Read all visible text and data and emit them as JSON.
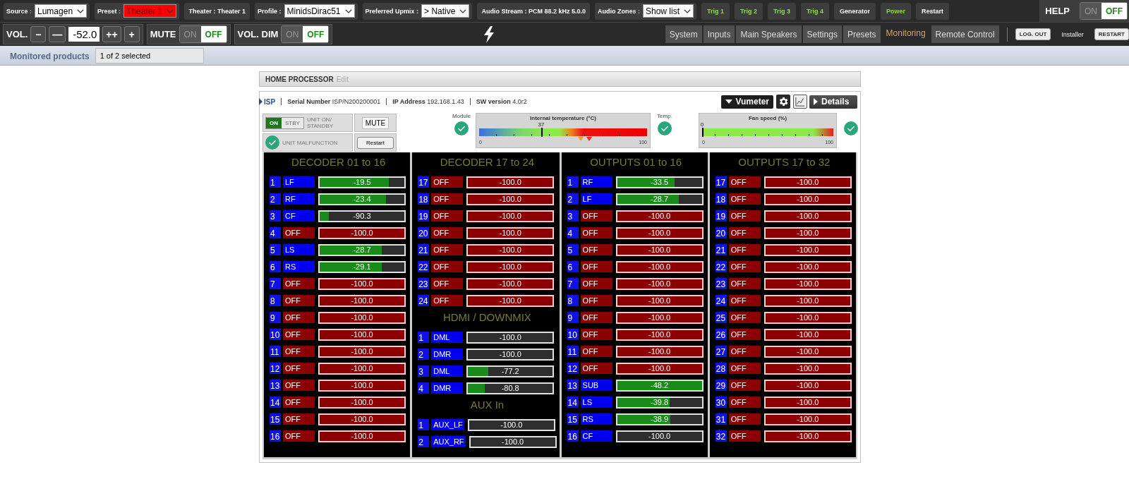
{
  "top_bar": {
    "fields": [
      {
        "kind": "select",
        "label": "Source :",
        "value": "Lumagen",
        "alert": false
      },
      {
        "kind": "select",
        "label": "Preset :",
        "value": "Theater 1",
        "alert": true
      },
      {
        "kind": "info",
        "label": "Theater : Theater 1"
      },
      {
        "kind": "select",
        "label": "Profile :",
        "value": "MinidsDirac51",
        "alert": false
      },
      {
        "kind": "select",
        "label": "Preferred Upmix :",
        "value": "> Native",
        "alert": false
      },
      {
        "kind": "info",
        "label": "Audio Stream : PCM 88.2 kHz 5.0.0"
      },
      {
        "kind": "select",
        "label": "Audio Zones :",
        "value": "Show list",
        "alert": false
      }
    ],
    "buttons": [
      {
        "label": "Trig 1",
        "active": true
      },
      {
        "label": "Trig 2",
        "active": true
      },
      {
        "label": "Trig 3",
        "active": true
      },
      {
        "label": "Trig 4",
        "active": true
      },
      {
        "label": "Generator",
        "active": false
      },
      {
        "label": "Power",
        "active": true
      },
      {
        "label": "Restart",
        "active": false
      }
    ],
    "help": {
      "label": "HELP",
      "options": [
        {
          "label": "ON",
          "selected": false
        },
        {
          "label": "OFF",
          "selected": true
        }
      ]
    }
  },
  "control_bar": {
    "volume": {
      "label": "VOL.",
      "buttons_before": [
        "−",
        "—"
      ],
      "value": "-52.0",
      "buttons_after": [
        "++",
        "+"
      ]
    },
    "toggles": [
      {
        "label": "MUTE",
        "options": [
          {
            "label": "ON",
            "selected": false
          },
          {
            "label": "OFF",
            "selected": true
          }
        ]
      },
      {
        "label": "VOL. DIM",
        "options": [
          {
            "label": "ON",
            "selected": false
          },
          {
            "label": "OFF",
            "selected": true
          }
        ]
      }
    ],
    "tabs": [
      {
        "label": "System",
        "selected": false
      },
      {
        "label": "Inputs",
        "selected": false
      },
      {
        "label": "Main Speakers",
        "selected": false
      },
      {
        "label": "Settings",
        "selected": false
      },
      {
        "label": "Presets",
        "selected": false
      },
      {
        "label": "Monitoring",
        "selected": true
      },
      {
        "label": "Remote Control",
        "selected": false
      }
    ],
    "logout": "LOG. OUT",
    "user": "Installer",
    "restart": "RESTART"
  },
  "products_bar": {
    "tab": "Monitored products",
    "selection": "1 of 2 selected"
  },
  "panel": {
    "title": "HOME PROCESSOR",
    "edit": "Edit",
    "device": {
      "name": "ISP",
      "info": [
        {
          "label": "Serial Number",
          "value": "ISP/N200200001"
        },
        {
          "label": "IP Address",
          "value": "192.168.1.43"
        },
        {
          "label": "SW version",
          "value": "4.0r2"
        }
      ],
      "buttons": {
        "vumeter": "Vumeter",
        "details": "Details"
      }
    },
    "power": {
      "options": [
        {
          "label": "ON",
          "selected": true
        },
        {
          "label": "STBY",
          "selected": false
        }
      ],
      "label": "UNIT ON/ STANDBY",
      "mute": "MUTE",
      "malfunction": "UNIT MALFUNCTION",
      "restart": "Restart"
    },
    "module_label": "Module",
    "temp_label": "Temp.",
    "temperature": {
      "title": "Internal temperature (°C)",
      "reading": "37",
      "level": 0.37,
      "min": "0",
      "max": "100"
    },
    "fan": {
      "title": "Fan speed (%)",
      "reading": "0",
      "level": 0,
      "min": "0",
      "max": "100"
    },
    "columns": [
      {
        "sections": [
          {
            "title": "DECODER 01 to 16",
            "channels": [
              {
                "number": "1",
                "name": "LF",
                "off": false,
                "level": 0.82,
                "reading": "-19.5"
              },
              {
                "number": "2",
                "name": "RF",
                "off": false,
                "level": 0.78,
                "reading": "-23.4"
              },
              {
                "number": "3",
                "name": "CF",
                "off": false,
                "level": 0.11,
                "reading": "-90.3"
              },
              {
                "number": "4",
                "name": "OFF",
                "off": true,
                "reading": "-100.0"
              },
              {
                "number": "5",
                "name": "LS",
                "off": false,
                "level": 0.73,
                "reading": "-28.7"
              },
              {
                "number": "6",
                "name": "RS",
                "off": false,
                "level": 0.73,
                "reading": "-29.1"
              },
              {
                "number": "7",
                "name": "OFF",
                "off": true,
                "reading": "-100.0"
              },
              {
                "number": "8",
                "name": "OFF",
                "off": true,
                "reading": "-100.0"
              },
              {
                "number": "9",
                "name": "OFF",
                "off": true,
                "reading": "-100.0"
              },
              {
                "number": "10",
                "name": "OFF",
                "off": true,
                "reading": "-100.0"
              },
              {
                "number": "11",
                "name": "OFF",
                "off": true,
                "reading": "-100.0"
              },
              {
                "number": "12",
                "name": "OFF",
                "off": true,
                "reading": "-100.0"
              },
              {
                "number": "13",
                "name": "OFF",
                "off": true,
                "reading": "-100.0"
              },
              {
                "number": "14",
                "name": "OFF",
                "off": true,
                "reading": "-100.0"
              },
              {
                "number": "15",
                "name": "OFF",
                "off": true,
                "reading": "-100.0"
              },
              {
                "number": "16",
                "name": "OFF",
                "off": true,
                "reading": "-100.0"
              }
            ]
          }
        ]
      },
      {
        "sections": [
          {
            "title": "DECODER 17 to 24",
            "channels": [
              {
                "number": "17",
                "name": "OFF",
                "off": true,
                "reading": "-100.0"
              },
              {
                "number": "18",
                "name": "OFF",
                "off": true,
                "reading": "-100.0"
              },
              {
                "number": "19",
                "name": "OFF",
                "off": true,
                "reading": "-100.0"
              },
              {
                "number": "20",
                "name": "OFF",
                "off": true,
                "reading": "-100.0"
              },
              {
                "number": "21",
                "name": "OFF",
                "off": true,
                "reading": "-100.0"
              },
              {
                "number": "22",
                "name": "OFF",
                "off": true,
                "reading": "-100.0"
              },
              {
                "number": "23",
                "name": "OFF",
                "off": true,
                "reading": "-100.0"
              },
              {
                "number": "24",
                "name": "OFF",
                "off": true,
                "reading": "-100.0"
              }
            ]
          },
          {
            "title": "HDMI / DOWNMIX",
            "channels": [
              {
                "number": "1",
                "name": "DML",
                "off": false,
                "reading": "-100.0"
              },
              {
                "number": "2",
                "name": "DMR",
                "off": false,
                "reading": "-100.0"
              },
              {
                "number": "3",
                "name": "DML",
                "off": false,
                "level": 0.24,
                "reading": "-77.2"
              },
              {
                "number": "4",
                "name": "DMR",
                "off": false,
                "level": 0.2,
                "reading": "-80.8"
              }
            ]
          },
          {
            "title": "AUX In",
            "channels": [
              {
                "number": "1",
                "name": "AUX_LF",
                "off": false,
                "reading": "-100.0"
              },
              {
                "number": "2",
                "name": "AUX_RF",
                "off": false,
                "reading": "-100.0"
              }
            ]
          }
        ]
      },
      {
        "sections": [
          {
            "title": "OUTPUTS 01 to 16",
            "channels": [
              {
                "number": "1",
                "name": "RF",
                "off": false,
                "level": 0.68,
                "reading": "-33.5"
              },
              {
                "number": "2",
                "name": "LF",
                "off": false,
                "level": 0.73,
                "reading": "-28.7"
              },
              {
                "number": "3",
                "name": "OFF",
                "off": true,
                "reading": "-100.0"
              },
              {
                "number": "4",
                "name": "OFF",
                "off": true,
                "reading": "-100.0"
              },
              {
                "number": "5",
                "name": "OFF",
                "off": true,
                "reading": "-100.0"
              },
              {
                "number": "6",
                "name": "OFF",
                "off": true,
                "reading": "-100.0"
              },
              {
                "number": "7",
                "name": "OFF",
                "off": true,
                "reading": "-100.0"
              },
              {
                "number": "8",
                "name": "OFF",
                "off": true,
                "reading": "-100.0"
              },
              {
                "number": "9",
                "name": "OFF",
                "off": true,
                "reading": "-100.0"
              },
              {
                "number": "10",
                "name": "OFF",
                "off": true,
                "reading": "-100.0"
              },
              {
                "number": "11",
                "name": "OFF",
                "off": true,
                "reading": "-100.0"
              },
              {
                "number": "12",
                "name": "OFF",
                "off": true,
                "reading": "-100.0"
              },
              {
                "number": "13",
                "name": "SUB",
                "off": false,
                "level": 1,
                "reading": "-48.2"
              },
              {
                "number": "14",
                "name": "LS",
                "off": false,
                "level": 0.62,
                "reading": "-39.8"
              },
              {
                "number": "15",
                "name": "RS",
                "off": false,
                "level": 0.63,
                "reading": "-38.9"
              },
              {
                "number": "16",
                "name": "CF",
                "off": false,
                "reading": "-100.0"
              }
            ]
          }
        ]
      },
      {
        "sections": [
          {
            "title": "OUTPUTS 17 to 32",
            "channels": [
              {
                "number": "17",
                "name": "OFF",
                "off": true,
                "reading": "-100.0"
              },
              {
                "number": "18",
                "name": "OFF",
                "off": true,
                "reading": "-100.0"
              },
              {
                "number": "19",
                "name": "OFF",
                "off": true,
                "reading": "-100.0"
              },
              {
                "number": "20",
                "name": "OFF",
                "off": true,
                "reading": "-100.0"
              },
              {
                "number": "21",
                "name": "OFF",
                "off": true,
                "reading": "-100.0"
              },
              {
                "number": "22",
                "name": "OFF",
                "off": true,
                "reading": "-100.0"
              },
              {
                "number": "23",
                "name": "OFF",
                "off": true,
                "reading": "-100.0"
              },
              {
                "number": "24",
                "name": "OFF",
                "off": true,
                "reading": "-100.0"
              },
              {
                "number": "25",
                "name": "OFF",
                "off": true,
                "reading": "-100.0"
              },
              {
                "number": "26",
                "name": "OFF",
                "off": true,
                "reading": "-100.0"
              },
              {
                "number": "27",
                "name": "OFF",
                "off": true,
                "reading": "-100.0"
              },
              {
                "number": "28",
                "name": "OFF",
                "off": true,
                "reading": "-100.0"
              },
              {
                "number": "29",
                "name": "OFF",
                "off": true,
                "reading": "-100.0"
              },
              {
                "number": "30",
                "name": "OFF",
                "off": true,
                "reading": "-100.0"
              },
              {
                "number": "31",
                "name": "OFF",
                "off": true,
                "reading": "-100.0"
              },
              {
                "number": "32",
                "name": "OFF",
                "off": true,
                "reading": "-100.0"
              }
            ]
          }
        ]
      }
    ]
  }
}
